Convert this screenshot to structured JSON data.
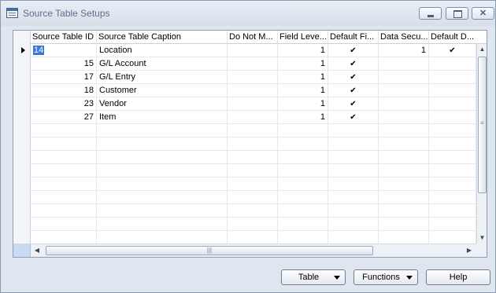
{
  "window": {
    "title": "Source Table Setups"
  },
  "window_controls": {
    "close_glyph": "✕"
  },
  "grid": {
    "columns": [
      "Source Table ID",
      "Source Table Caption",
      "Do Not M...",
      "Field Leve...",
      "Default Fi...",
      "Data Secu...",
      "Default D..."
    ],
    "rows": [
      {
        "id": "14",
        "caption": "Location",
        "do_not_m": "",
        "field_level": "1",
        "default_fi": "✔",
        "data_secu": "1",
        "default_d": "✔"
      },
      {
        "id": "15",
        "caption": "G/L Account",
        "do_not_m": "",
        "field_level": "1",
        "default_fi": "✔",
        "data_secu": "",
        "default_d": ""
      },
      {
        "id": "17",
        "caption": "G/L Entry",
        "do_not_m": "",
        "field_level": "1",
        "default_fi": "✔",
        "data_secu": "",
        "default_d": ""
      },
      {
        "id": "18",
        "caption": "Customer",
        "do_not_m": "",
        "field_level": "1",
        "default_fi": "✔",
        "data_secu": "",
        "default_d": ""
      },
      {
        "id": "23",
        "caption": "Vendor",
        "do_not_m": "",
        "field_level": "1",
        "default_fi": "✔",
        "data_secu": "",
        "default_d": ""
      },
      {
        "id": "27",
        "caption": "Item",
        "do_not_m": "",
        "field_level": "1",
        "default_fi": "✔",
        "data_secu": "",
        "default_d": ""
      }
    ],
    "selected_row": 0
  },
  "buttons": {
    "table": "Table",
    "functions": "Functions",
    "help": "Help"
  },
  "scrollbars": {
    "v_up": "▲",
    "v_down": "▼",
    "v_grip": "≡",
    "h_left": "◀",
    "h_right": "▶",
    "h_grip": "|||"
  }
}
